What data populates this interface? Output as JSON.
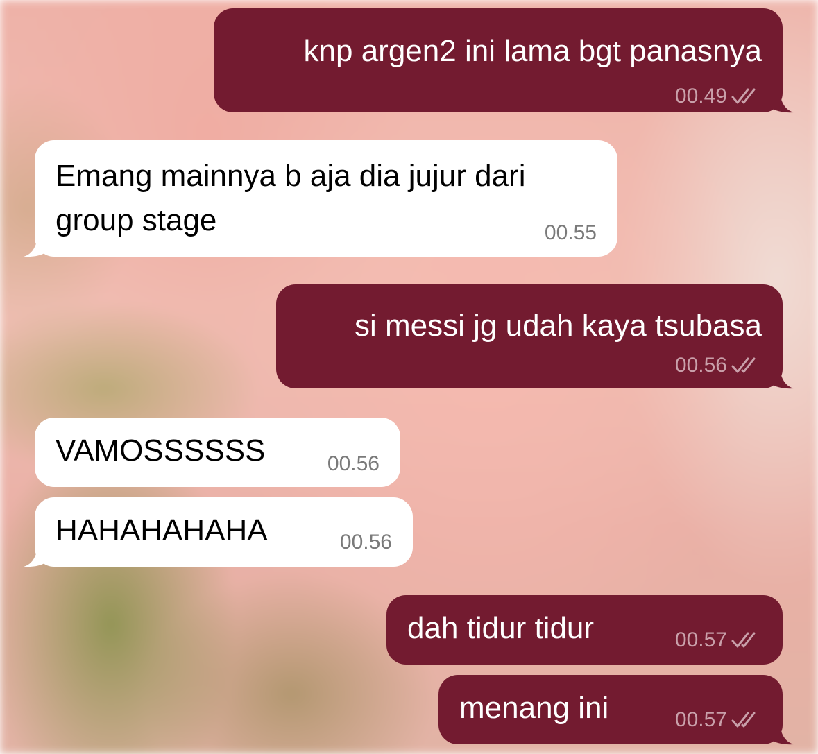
{
  "colors": {
    "outgoing_bubble": "#731b30",
    "incoming_bubble": "#ffffff",
    "outgoing_text": "#ffffff",
    "incoming_text": "#000000"
  },
  "messages": [
    {
      "direction": "outgoing",
      "lines": [
        "knp argen2 ini lama bgt panasnya"
      ],
      "time": "00.49",
      "status_icon": "double-check-icon"
    },
    {
      "direction": "incoming",
      "lines": [
        "Emang mainnya b aja dia jujur dari",
        "group stage"
      ],
      "time": "00.55"
    },
    {
      "direction": "outgoing",
      "lines": [
        "si messi jg udah kaya tsubasa"
      ],
      "time": "00.56",
      "status_icon": "double-check-icon"
    },
    {
      "direction": "incoming",
      "lines": [
        "VAMOSSSSSS"
      ],
      "time": "00.56"
    },
    {
      "direction": "incoming",
      "lines": [
        "HAHAHAHAHA"
      ],
      "time": "00.56"
    },
    {
      "direction": "outgoing",
      "lines": [
        "dah tidur tidur"
      ],
      "time": "00.57",
      "status_icon": "double-check-icon"
    },
    {
      "direction": "outgoing",
      "lines": [
        "menang ini"
      ],
      "time": "00.57",
      "status_icon": "double-check-icon"
    }
  ]
}
